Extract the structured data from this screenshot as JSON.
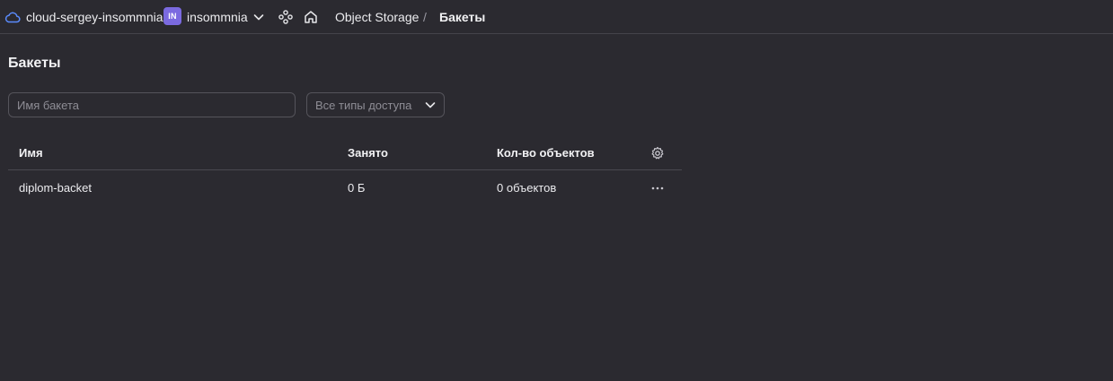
{
  "topbar": {
    "cloud_name": "cloud-sergey-insommnia",
    "folder_badge": "IN",
    "folder_name": "insommnia",
    "service_name": "Object Storage",
    "separator": "/",
    "current_page": "Бакеты",
    "icons": [
      "cloud-icon",
      "chevron-down-icon",
      "services-icon",
      "home-icon"
    ]
  },
  "page": {
    "title": "Бакеты"
  },
  "filters": {
    "search_placeholder": "Имя бакета",
    "search_value": "",
    "access_type_selected": "Все типы доступа"
  },
  "table": {
    "columns": [
      "Имя",
      "Занято",
      "Кол-во объектов"
    ],
    "rows": [
      {
        "name": "diplom-backet",
        "size": "0 Б",
        "objects": "0 объектов"
      }
    ]
  },
  "colors": {
    "background": "#2b2a30",
    "folder_badge": "#7b6ae0",
    "cloud_icon": "#5b8cff"
  }
}
